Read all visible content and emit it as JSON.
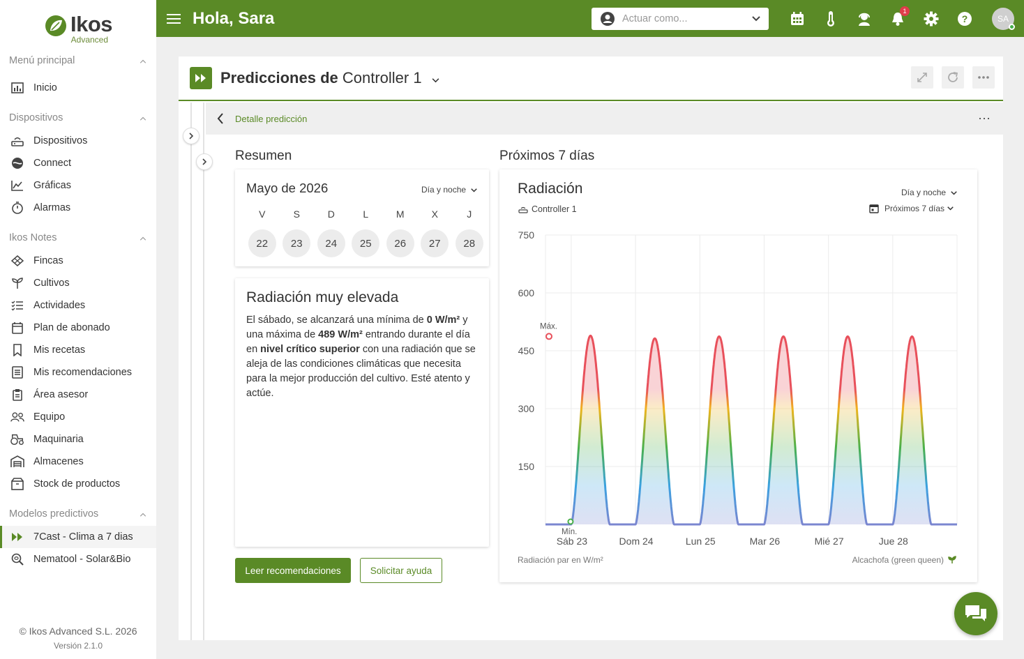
{
  "brand": {
    "name": "Ikos",
    "sub": "Advanced",
    "color": "#5a8a26"
  },
  "topbar": {
    "greeting": "Hola, Sara",
    "act_as_placeholder": "Actuar como...",
    "notifications_count": "1",
    "avatar_initials": "SA",
    "icons": [
      "calendar-icon",
      "thermometer-icon",
      "support-agent-icon",
      "bell-icon",
      "gear-icon",
      "help-icon"
    ]
  },
  "sidebar": {
    "sections": [
      {
        "title": "Menú principal",
        "items": [
          {
            "label": "Inicio",
            "icon": "dashboard-icon"
          }
        ]
      },
      {
        "title": "Dispositivos",
        "items": [
          {
            "label": "Dispositivos",
            "icon": "router-icon"
          },
          {
            "label": "Connect",
            "icon": "connect-icon"
          },
          {
            "label": "Gráficas",
            "icon": "chart-icon"
          },
          {
            "label": "Alarmas",
            "icon": "stopwatch-icon"
          }
        ]
      },
      {
        "title": "Ikos Notes",
        "items": [
          {
            "label": "Fincas",
            "icon": "field-icon"
          },
          {
            "label": "Cultivos",
            "icon": "sprout-icon"
          },
          {
            "label": "Actividades",
            "icon": "checklist-icon"
          },
          {
            "label": "Plan de abonado",
            "icon": "calendar-icon"
          },
          {
            "label": "Mis recetas",
            "icon": "bookmark-icon"
          },
          {
            "label": "Mis recomendaciones",
            "icon": "list-icon"
          },
          {
            "label": "Área asesor",
            "icon": "clipboard-icon"
          },
          {
            "label": "Equipo",
            "icon": "team-icon"
          },
          {
            "label": "Maquinaria",
            "icon": "tractor-icon"
          },
          {
            "label": "Almacenes",
            "icon": "warehouse-icon"
          },
          {
            "label": "Stock de productos",
            "icon": "box-icon"
          }
        ]
      },
      {
        "title": "Modelos predictivos",
        "items": [
          {
            "label": "7Cast - Clima a 7 dias",
            "icon": "fast-forward-icon",
            "active": true
          },
          {
            "label": "Nematool - Solar&Bio",
            "icon": "search-bug-icon"
          }
        ]
      }
    ],
    "footer": {
      "copyright": "© Ikos Advanced S.L. 2026",
      "version": "Versión 2.1.0"
    }
  },
  "card": {
    "title_bold": "Predicciones de",
    "device": "Controller 1",
    "detail_label": "Detalle predicción"
  },
  "summary": {
    "section_title": "Resumen",
    "month": "Mayo de 2026",
    "mode": "Día y noche",
    "days": [
      {
        "letter": "V",
        "num": "22"
      },
      {
        "letter": "S",
        "num": "23"
      },
      {
        "letter": "D",
        "num": "24"
      },
      {
        "letter": "L",
        "num": "25"
      },
      {
        "letter": "M",
        "num": "26"
      },
      {
        "letter": "X",
        "num": "27"
      },
      {
        "letter": "J",
        "num": "28"
      }
    ],
    "alert_title": "Radiación muy elevada",
    "alert_p1": "El sábado, se alcanzará una mínima de ",
    "alert_min": "0 W/m²",
    "alert_p2": " y una máxima de ",
    "alert_max": "489 W/m²",
    "alert_p3": " entrando durante el día en ",
    "alert_level": "nivel crítico superior",
    "alert_p4": " con una radiación que se aleja de las condiciones climáticas que necesita para la mejor producción del cultivo. Esté atento y actúe.",
    "btn_primary": "Leer recomendaciones",
    "btn_secondary": "Solicitar ayuda"
  },
  "forecast": {
    "section_title": "Próximos 7 días",
    "chart_title": "Radiación",
    "device": "Controller 1",
    "mode": "Día y noche",
    "range": "Próximos 7 días",
    "footer_left": "Radiación par en W/m²",
    "footer_right": "Alcachofa (green queen)",
    "max_label": "Máx.",
    "min_label": "Mín."
  },
  "chart_data": {
    "type": "area",
    "title": "Radiación",
    "ylabel": "Radiación par en W/m²",
    "ylim": [
      0,
      750
    ],
    "yticks": [
      150,
      300,
      450,
      600,
      750
    ],
    "x_tick_labels": [
      "Sáb 23",
      "Dom 24",
      "Lun 25",
      "Mar 26",
      "Mié 27",
      "Jue 28"
    ],
    "x_tick_days": [
      1,
      2,
      3,
      4,
      5,
      6
    ],
    "xlim_days": [
      0.6,
      7.0
    ],
    "peaks": [
      {
        "day": 1,
        "peak": 489
      },
      {
        "day": 2,
        "peak": 482
      },
      {
        "day": 3,
        "peak": 487
      },
      {
        "day": 4,
        "peak": 487
      },
      {
        "day": 5,
        "peak": 487
      },
      {
        "day": 6,
        "peak": 487
      }
    ],
    "initial_value": 489,
    "min_value": 0,
    "gradient_stops": [
      {
        "value": 0,
        "color": "#7b86d0"
      },
      {
        "value": 100,
        "color": "#3aa1e0"
      },
      {
        "value": 200,
        "color": "#4ab04a"
      },
      {
        "value": 300,
        "color": "#f0b41e"
      },
      {
        "value": 350,
        "color": "#e8505b"
      },
      {
        "value": 489,
        "color": "#e8505b"
      }
    ],
    "grid": true
  }
}
